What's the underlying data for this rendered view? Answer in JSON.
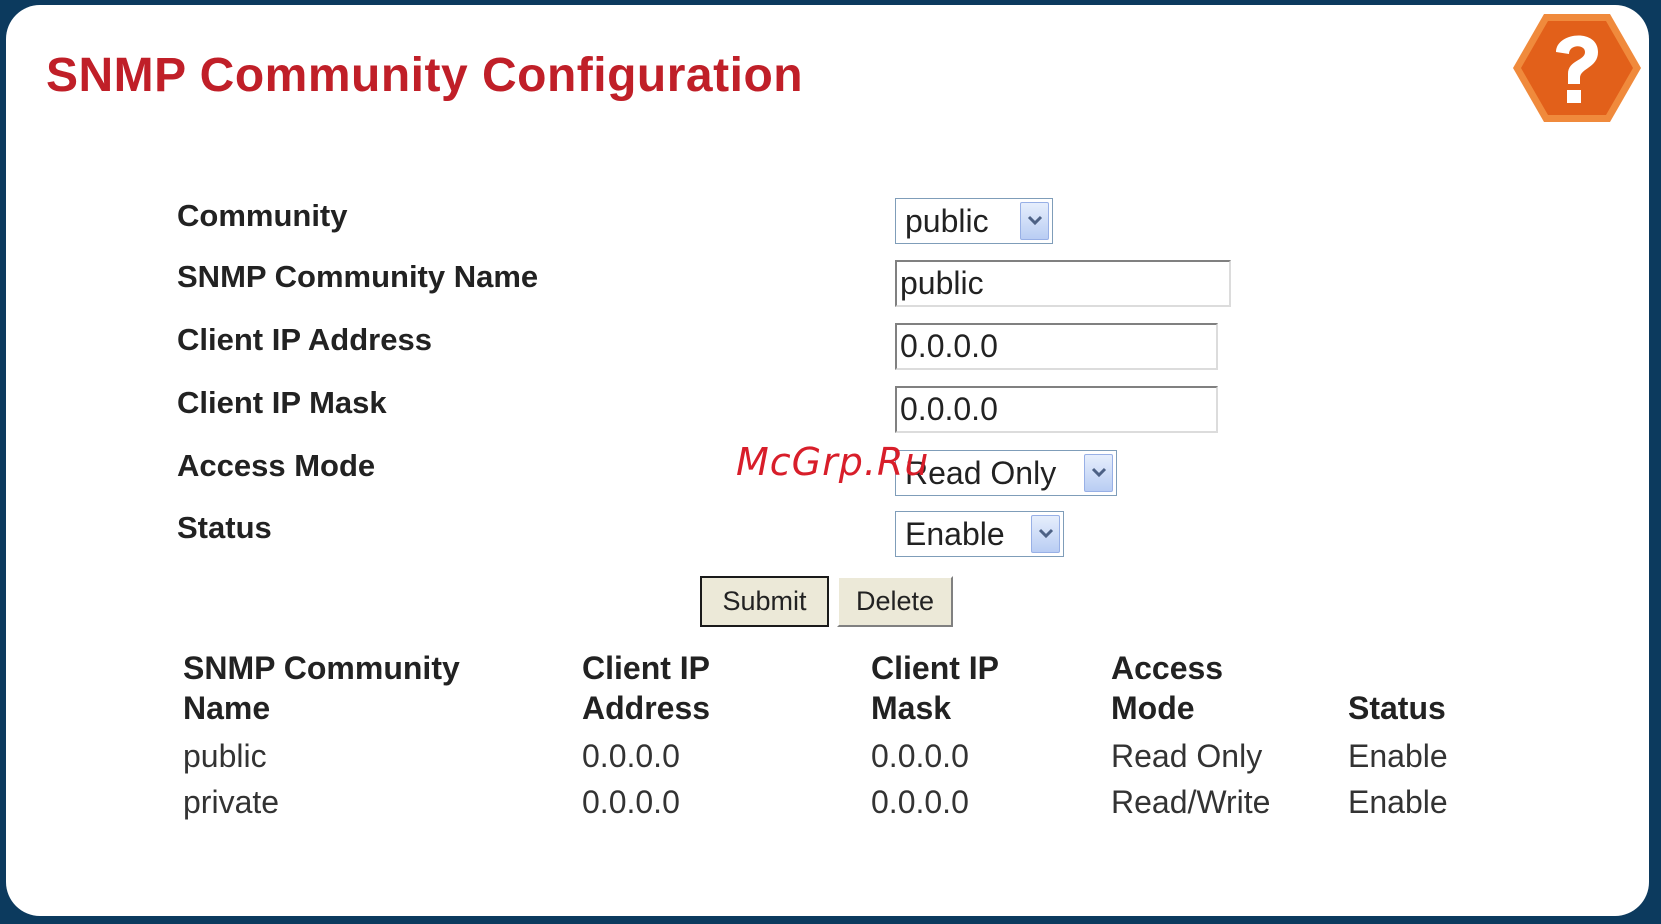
{
  "page": {
    "title": "SNMP Community Configuration",
    "help_icon": "help-question-icon",
    "accent_color": "#c01f28",
    "help_icon_color": "#ea6a1f"
  },
  "form": {
    "community": {
      "label": "Community",
      "value": "public"
    },
    "community_name": {
      "label": "SNMP Community Name",
      "value": "public"
    },
    "client_ip_address": {
      "label": "Client IP Address",
      "value": "0.0.0.0"
    },
    "client_ip_mask": {
      "label": "Client IP Mask",
      "value": "0.0.0.0"
    },
    "access_mode": {
      "label": "Access Mode",
      "value": "Read Only"
    },
    "status": {
      "label": "Status",
      "value": "Enable"
    }
  },
  "buttons": {
    "submit": "Submit",
    "delete": "Delete"
  },
  "table": {
    "headers": [
      [
        "SNMP Community",
        "Name"
      ],
      [
        "Client IP",
        "Address"
      ],
      [
        "Client IP",
        "Mask"
      ],
      [
        "Access",
        "Mode"
      ],
      [
        "",
        "Status"
      ]
    ],
    "rows": [
      [
        "public",
        "0.0.0.0",
        "0.0.0.0",
        "Read Only",
        "Enable"
      ],
      [
        "private",
        "0.0.0.0",
        "0.0.0.0",
        "Read/Write",
        "Enable"
      ]
    ]
  },
  "watermark": "McGrp.Ru"
}
